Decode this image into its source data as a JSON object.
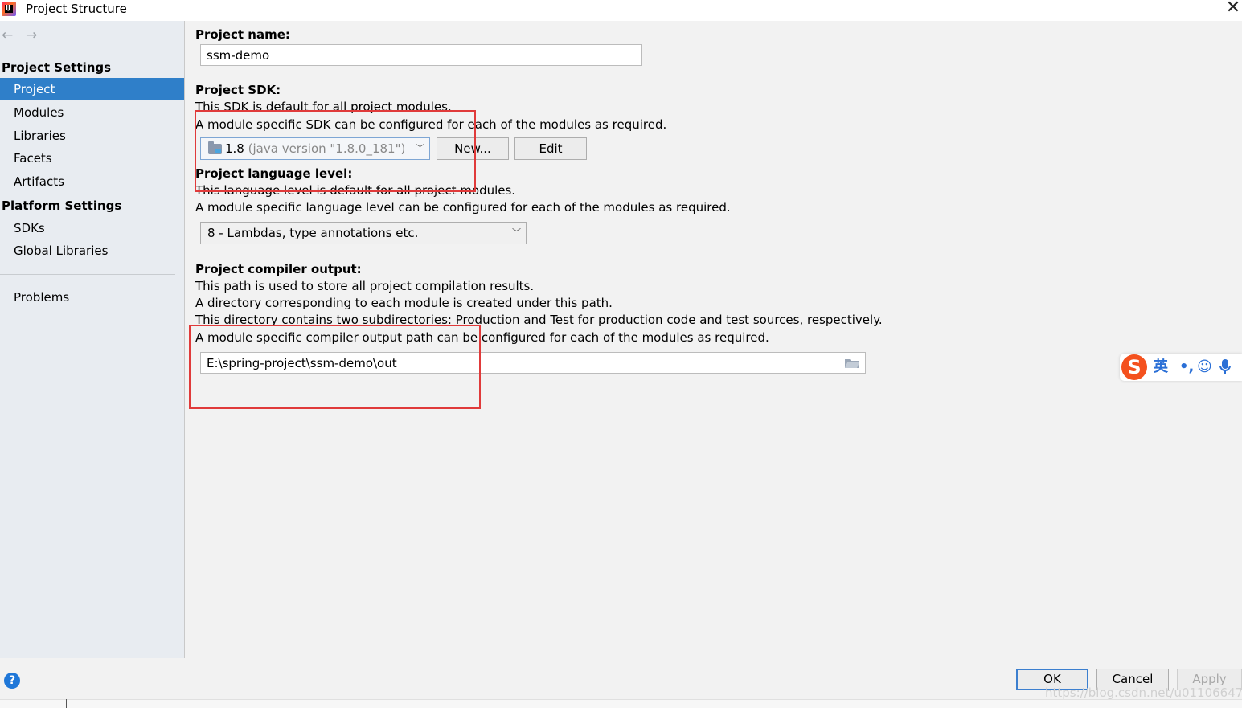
{
  "window": {
    "title": "Project Structure",
    "close_glyph": "✕"
  },
  "nav": {
    "back_glyph": "←",
    "forward_glyph": "→"
  },
  "sidebar": {
    "project_settings_header": "Project Settings",
    "project_items": [
      {
        "label": "Project",
        "selected": true
      },
      {
        "label": "Modules"
      },
      {
        "label": "Libraries"
      },
      {
        "label": "Facets"
      },
      {
        "label": "Artifacts"
      }
    ],
    "platform_settings_header": "Platform Settings",
    "platform_items": [
      {
        "label": "SDKs"
      },
      {
        "label": "Global Libraries"
      }
    ],
    "problems_label": "Problems"
  },
  "project_name": {
    "label": "Project name:",
    "value": "ssm-demo"
  },
  "project_sdk": {
    "label": "Project SDK:",
    "desc1": "This SDK is default for all project modules.",
    "desc2": "A module specific SDK can be configured for each of the modules as required.",
    "selected_version": "1.8",
    "selected_detail": "(java version \"1.8.0_181\")",
    "new_button": "New...",
    "edit_button": "Edit"
  },
  "language_level": {
    "label": "Project language level:",
    "desc1": "This language level is default for all project modules.",
    "desc2": "A module specific language level can be configured for each of the modules as required.",
    "selected": "8 - Lambdas, type annotations etc."
  },
  "compiler_output": {
    "label": "Project compiler output:",
    "desc1": "This path is used to store all project compilation results.",
    "desc2": "A directory corresponding to each module is created under this path.",
    "desc3": "This directory contains two subdirectories: Production and Test for production code and test sources, respectively.",
    "desc4": "A module specific compiler output path can be configured for each of the modules as required.",
    "path": "E:\\spring-project\\ssm-demo\\out"
  },
  "ime": {
    "logo": "S",
    "lang": "英",
    "punct": "•,",
    "emoji": "☺",
    "mic": "🎤"
  },
  "footer": {
    "help": "?",
    "ok": "OK",
    "cancel": "Cancel",
    "apply": "Apply",
    "watermark": "https://blog.csdn.net/u011066470"
  },
  "colors": {
    "selection": "#2f7fc9",
    "annotation": "#e03a3a",
    "default_button_border": "#3c7fcf"
  }
}
